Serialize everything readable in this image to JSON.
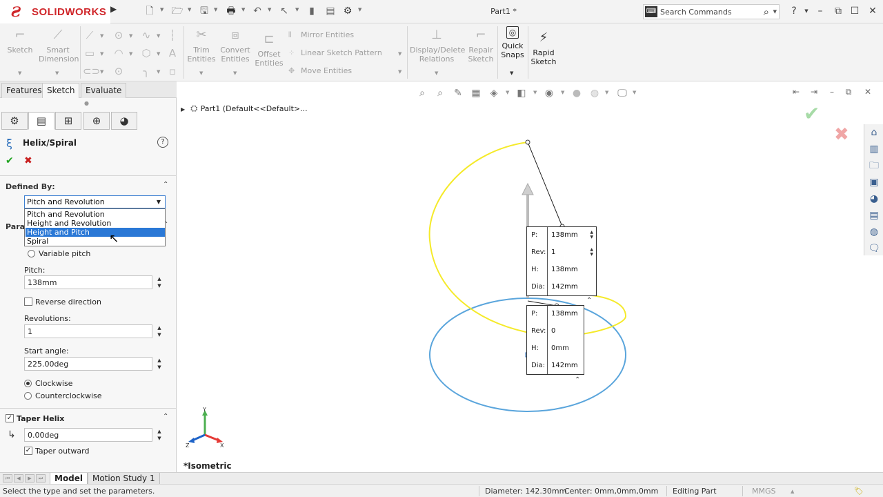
{
  "app": {
    "name": "SOLIDWORKS",
    "document_title": "Part1 *",
    "search_placeholder": "Search Commands",
    "help": "?"
  },
  "commands": {
    "sketch": "Sketch",
    "smart_dimension_1": "Smart",
    "smart_dimension_2": "Dimension",
    "trim_1": "Trim",
    "trim_2": "Entities",
    "convert_1": "Convert",
    "convert_2": "Entities",
    "offset_1": "Offset",
    "offset_2": "Entities",
    "mirror": "Mirror Entities",
    "linear_pattern": "Linear Sketch Pattern",
    "move": "Move Entities",
    "display_delete_1": "Display/Delete",
    "display_delete_2": "Relations",
    "repair_1": "Repair",
    "repair_2": "Sketch",
    "quick_snaps_1": "Quick",
    "quick_snaps_2": "Snaps",
    "rapid_sketch_1": "Rapid",
    "rapid_sketch_2": "Sketch"
  },
  "tabs": [
    "Features",
    "Sketch",
    "Evaluate"
  ],
  "property_manager": {
    "title": "Helix/Spiral",
    "help": "?",
    "defined_by_label": "Defined By:",
    "defined_by_value": "Pitch and Revolution",
    "options": [
      "Pitch and Revolution",
      "Height and Revolution",
      "Height and Pitch",
      "Spiral"
    ],
    "parameters_label": "Param",
    "variable_pitch": "Variable pitch",
    "pitch_label": "Pitch:",
    "pitch_value": "138mm",
    "reverse_direction": "Reverse direction",
    "revolutions_label": "Revolutions:",
    "revolutions_value": "1",
    "start_angle_label": "Start angle:",
    "start_angle_value": "225.00deg",
    "clockwise": "Clockwise",
    "counterclockwise": "Counterclockwise",
    "taper_helix": "Taper Helix",
    "taper_angle_value": "0.00deg",
    "taper_outward": "Taper outward"
  },
  "viewport": {
    "tree_item": "Part1  (Default<<Default>...",
    "view_label": "*Isometric",
    "callout_top": {
      "p": "138mm",
      "rev": "1",
      "h": "138mm",
      "dia": "142mm"
    },
    "callout_bottom": {
      "p": "138mm",
      "rev": "0",
      "h": "0mm",
      "dia": "142mm"
    },
    "keys": {
      "p": "P:",
      "rev": "Rev:",
      "h": "H:",
      "dia": "Dia:"
    },
    "colors": {
      "helix": "#f5ea2a",
      "circle": "#5aa5dc"
    }
  },
  "bottom_tabs": [
    "Model",
    "Motion Study 1"
  ],
  "status": {
    "message": "Select the type and set the parameters.",
    "diameter": "Diameter: 142.30mm",
    "center": "Center: 0mm,0mm,0mm",
    "mode": "Editing Part",
    "units": "MMGS"
  }
}
